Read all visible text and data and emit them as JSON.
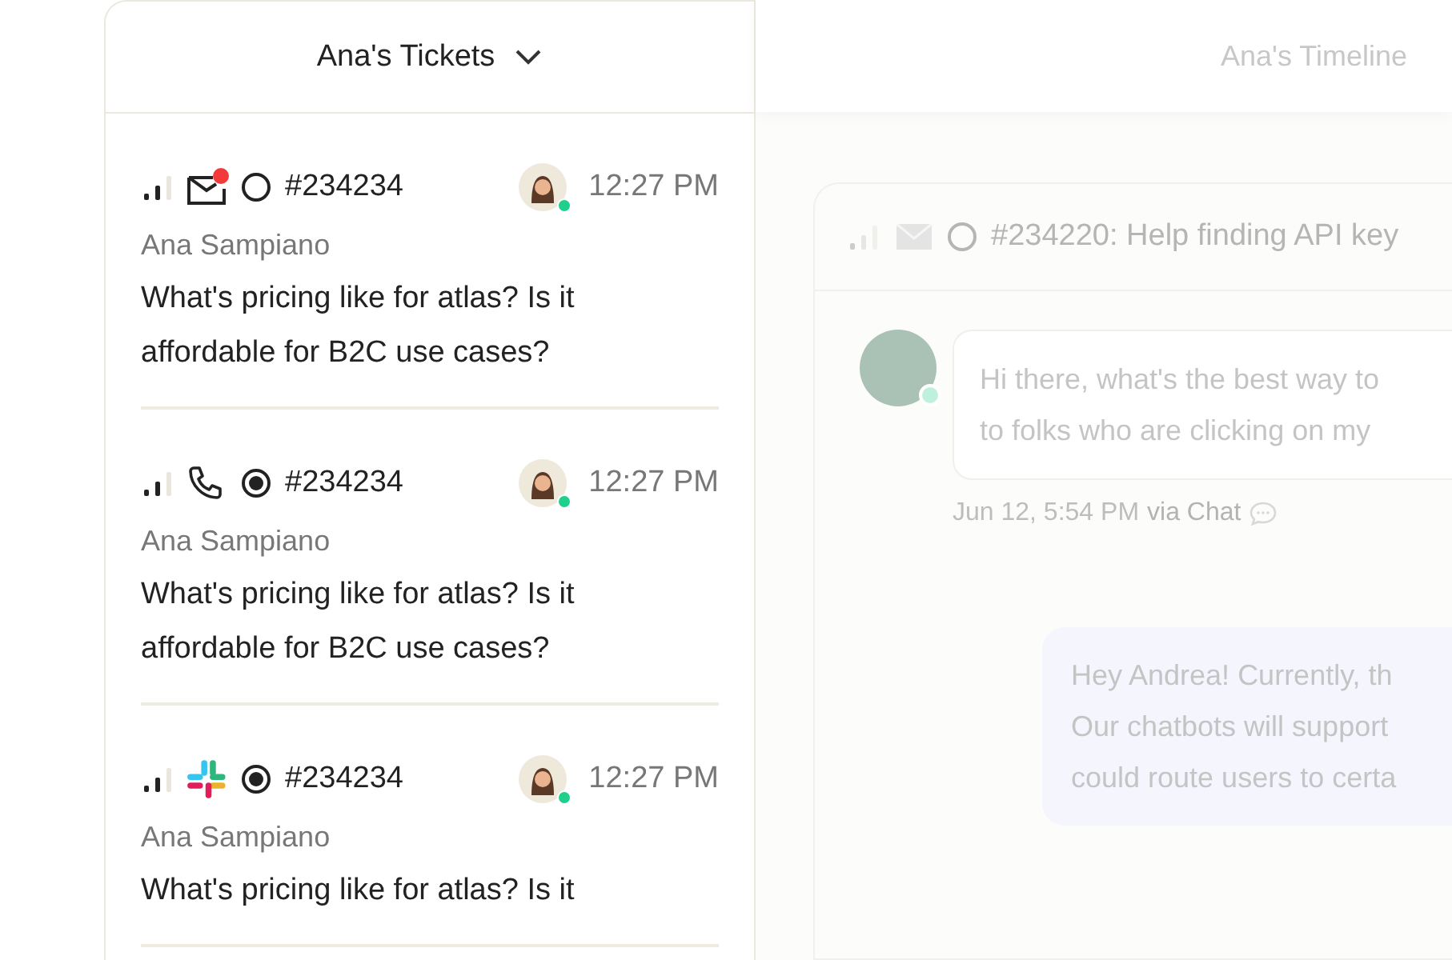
{
  "tickets_panel": {
    "title": "Ana's Tickets",
    "expanded": false,
    "tickets": [
      {
        "channel": {
          "kind": "email",
          "unread": true
        },
        "status": {
          "kind": "open"
        },
        "number": "#234234",
        "time": "12:27 PM",
        "requester": "Ana Sampiano",
        "message": "What's pricing like for atlas? Is it affordable for B2C use cases?"
      },
      {
        "channel": {
          "kind": "phone",
          "unread": false
        },
        "status": {
          "kind": "pending"
        },
        "number": "#234234",
        "time": "12:27 PM",
        "requester": "Ana Sampiano",
        "message": "What's pricing like for atlas? Is it affordable for B2C use cases?"
      },
      {
        "channel": {
          "kind": "slack",
          "unread": false
        },
        "status": {
          "kind": "pending"
        },
        "number": "#234234",
        "time": "12:27 PM",
        "requester": "Ana Sampiano",
        "message": "What's pricing like for atlas? Is it"
      }
    ]
  },
  "timeline_panel": {
    "title": "Ana's Timeline",
    "conversation": {
      "channel": {
        "kind": "email"
      },
      "status": {
        "kind": "open"
      },
      "subject": "#234220: Help finding API key",
      "messages": [
        {
          "kind": "incoming",
          "lines": [
            "Hi there, what's the best way to",
            "to folks who are clicking on my"
          ],
          "timestamp": "Jun 12, 5:54 PM",
          "via": "via Chat"
        },
        {
          "kind": "outgoing",
          "lines": [
            "Hey Andrea! Currently, th",
            "Our chatbots will support",
            "could route users to certa"
          ]
        }
      ]
    }
  }
}
